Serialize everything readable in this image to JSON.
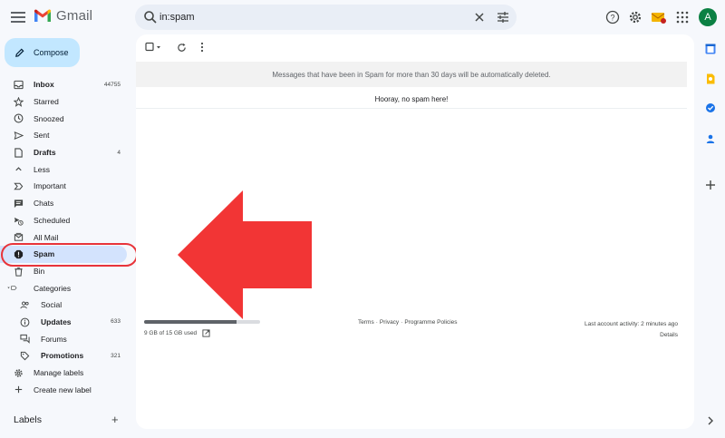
{
  "app": {
    "name": "Gmail"
  },
  "search": {
    "value": "in:spam"
  },
  "compose": {
    "label": "Compose"
  },
  "nav": [
    {
      "label": "Inbox",
      "count": "44755",
      "bold": true,
      "icon": "inbox-icon"
    },
    {
      "label": "Starred",
      "count": "",
      "icon": "star-icon"
    },
    {
      "label": "Snoozed",
      "count": "",
      "icon": "clock-icon"
    },
    {
      "label": "Sent",
      "count": "",
      "icon": "send-icon"
    },
    {
      "label": "Drafts",
      "count": "4",
      "bold": true,
      "icon": "draft-icon"
    },
    {
      "label": "Less",
      "count": "",
      "icon": "chevron-up-icon"
    },
    {
      "label": "Important",
      "count": "",
      "icon": "important-icon"
    },
    {
      "label": "Chats",
      "count": "",
      "icon": "chat-icon"
    },
    {
      "label": "Scheduled",
      "count": "",
      "icon": "scheduled-icon"
    },
    {
      "label": "All Mail",
      "count": "",
      "icon": "all-mail-icon"
    },
    {
      "label": "Spam",
      "count": "",
      "active": true,
      "icon": "spam-icon"
    },
    {
      "label": "Bin",
      "count": "",
      "icon": "trash-icon"
    },
    {
      "label": "Categories",
      "count": "",
      "icon": "label-icon"
    },
    {
      "label": "Social",
      "count": "",
      "sub": true,
      "icon": "social-icon"
    },
    {
      "label": "Updates",
      "count": "633",
      "sub": true,
      "bold": true,
      "icon": "info-icon"
    },
    {
      "label": "Forums",
      "count": "",
      "sub": true,
      "icon": "forum-icon"
    },
    {
      "label": "Promotions",
      "count": "321",
      "sub": true,
      "bold": true,
      "icon": "tag-icon"
    },
    {
      "label": "Manage labels",
      "count": "",
      "icon": "settings-icon"
    },
    {
      "label": "Create new label",
      "count": "",
      "icon": "plus-icon"
    }
  ],
  "labels": {
    "header": "Labels",
    "add": "+"
  },
  "main": {
    "notice": "Messages that have been in Spam for more than 30 days will be automatically deleted.",
    "empty": "Hooray, no spam here!"
  },
  "footer": {
    "storage_text": "9 GB of 15 GB used",
    "storage_fraction": 0.8,
    "terms": "Terms",
    "privacy": "Privacy",
    "policies": "Programme Policies",
    "sep": "·",
    "activity": "Last account activity: 2 minutes ago",
    "details": "Details"
  },
  "account": {
    "initial": "A",
    "avatar_color": "#0b8043"
  },
  "colors": {
    "accent": "#c2e7ff",
    "active_nav": "#d3e3fd",
    "highlight": "#e8343a"
  }
}
